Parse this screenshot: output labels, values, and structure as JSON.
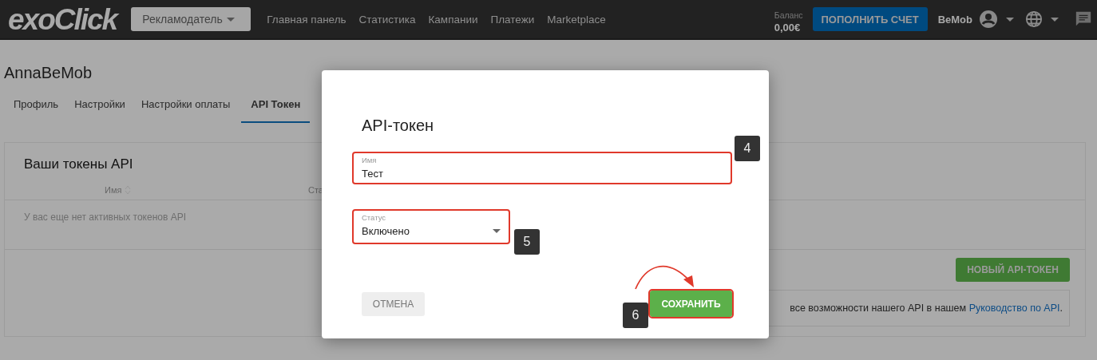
{
  "header": {
    "logo": "exoClick",
    "role_menu": "Рекламодатель",
    "nav": [
      {
        "label": "Главная панель"
      },
      {
        "label": "Статистика"
      },
      {
        "label": "Кампании"
      },
      {
        "label": "Платежи"
      },
      {
        "label": "Marketplace"
      }
    ],
    "balance_label": "Баланс",
    "balance_value": "0,00€",
    "top_up_button": "ПОПОЛНИТЬ СЧЕТ",
    "user": "BeMob"
  },
  "page": {
    "title": "AnnaBeMob",
    "tabs": [
      {
        "label": "Профиль",
        "selected": false
      },
      {
        "label": "Настройки",
        "selected": false
      },
      {
        "label": "Настройки оплаты",
        "selected": false
      },
      {
        "label": "API Токен",
        "selected": true
      }
    ],
    "card": {
      "title": "Ваши токены API",
      "columns": [
        "Имя",
        "Ста"
      ],
      "empty_message": "У вас еще нет активных токенов API",
      "new_token_button": "НОВЫЙ API-ТОКЕН",
      "info_text": "все возможности нашего API в нашем ",
      "info_link": "Руководство по API",
      "info_end": "."
    }
  },
  "dialog": {
    "title": "API-токен",
    "fields": [
      {
        "kind": "text",
        "label": "Имя",
        "value": "Тест",
        "highlighted": true,
        "annotation": "4"
      },
      {
        "kind": "select",
        "label": "Статус",
        "value": "Включено",
        "highlighted": true,
        "annotation": "5"
      }
    ],
    "cancel_button": {
      "label": "ОТМЕНА",
      "highlighted": false
    },
    "save_button": {
      "label": "СОХРАНИТЬ",
      "highlighted": true,
      "annotation": "6"
    }
  }
}
